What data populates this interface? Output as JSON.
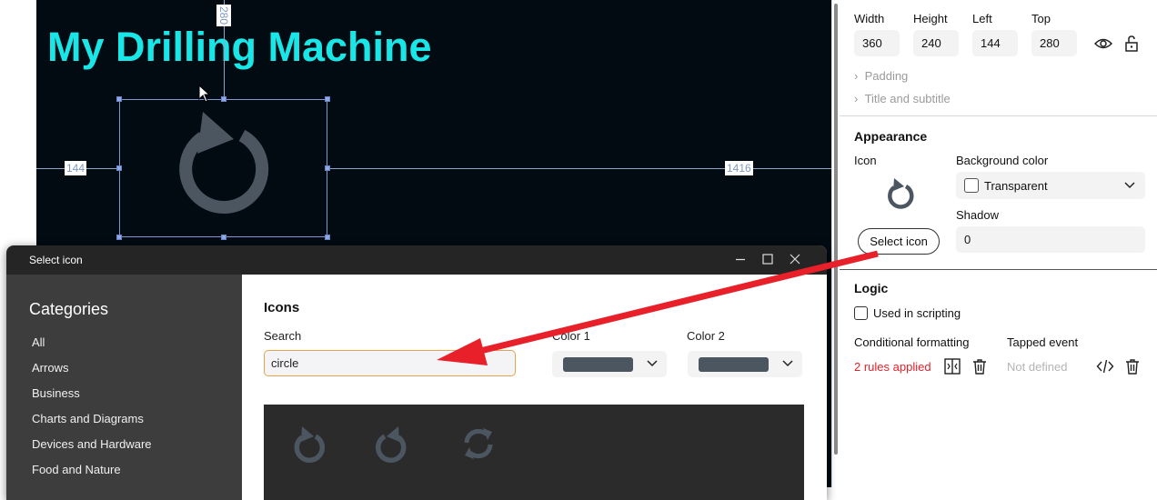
{
  "canvas": {
    "screen_title": "My Drilling Machine",
    "measure_top": "280",
    "measure_left": "144",
    "measure_right": "1416"
  },
  "dialog": {
    "title": "Select icon",
    "categories_heading": "Categories",
    "categories": [
      "All",
      "Arrows",
      "Business",
      "Charts and Diagrams",
      "Devices and Hardware",
      "Food and Nature"
    ],
    "icons_heading": "Icons",
    "search_label": "Search",
    "search_value": "circle",
    "color1_label": "Color 1",
    "color2_label": "Color 2",
    "color1_value": "#4b5661",
    "color2_value": "#4b5661",
    "results": [
      "rotate-right-circle-icon",
      "rotate-left-circle-icon",
      "refresh-circle-icon"
    ]
  },
  "props": {
    "width_label": "Width",
    "height_label": "Height",
    "left_label": "Left",
    "top_label": "Top",
    "width_value": "360",
    "height_value": "240",
    "left_value": "144",
    "top_value": "280",
    "padding_label": "Padding",
    "title_subtitle_label": "Title and subtitle",
    "appearance_heading": "Appearance",
    "icon_label": "Icon",
    "select_icon_button": "Select icon",
    "background_color_label": "Background color",
    "background_color_value": "Transparent",
    "shadow_label": "Shadow",
    "shadow_value": "0",
    "logic_heading": "Logic",
    "used_in_scripting_label": "Used in scripting",
    "conditional_formatting_label": "Conditional formatting",
    "conditional_formatting_value": "2 rules applied",
    "tapped_event_label": "Tapped event",
    "tapped_event_value": "Not defined"
  },
  "colors": {
    "title_cyan": "#19e6e6",
    "canvas_bg": "#020a12",
    "icon_gray": "#4b5661",
    "alert_red": "#e8202a",
    "search_border": "#e8a44a"
  }
}
